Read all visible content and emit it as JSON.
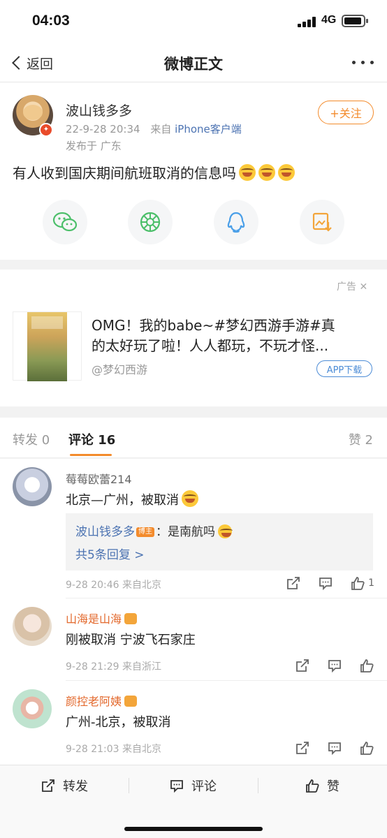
{
  "status_bar": {
    "time": "04:03",
    "network": "4G"
  },
  "nav": {
    "back_label": "返回",
    "title": "微博正文"
  },
  "post": {
    "author": "波山钱多多",
    "follow_label": "+关注",
    "time": "22-9-28 20:34",
    "from_prefix": "来自",
    "source": "iPhone客户端",
    "location": "发布于 广东",
    "text": "有人收到国庆期间航班取消的信息吗"
  },
  "share": {
    "items": [
      {
        "name": "wechat",
        "color": "#4cbf6a"
      },
      {
        "name": "moments",
        "color": "#4cbf6a"
      },
      {
        "name": "qq",
        "color": "#4a9fe8"
      },
      {
        "name": "save-image",
        "color": "#f3a53a"
      }
    ]
  },
  "ad": {
    "label": "广告",
    "line1": "OMG！我的babe~#梦幻西游手游#真",
    "line2": "的太好玩了啦！人人都玩，不玩才怪...",
    "brand": "@梦幻西游",
    "download_label": "APP下载"
  },
  "tabs": {
    "repost": "转发 0",
    "comments": "评论 16",
    "likes": "赞 2"
  },
  "comments": [
    {
      "user": "莓莓欧蕾214",
      "text": "北京—广州，被取消",
      "reply": {
        "author": "波山钱多多",
        "badge": "博主",
        "text": "：是南航吗",
        "more": "共5条回复 >"
      },
      "meta": "9-28 20:46  来自北京",
      "likes": "1"
    },
    {
      "user": "山海是山海",
      "text": "刚被取消  宁波飞石家庄",
      "meta": "9-28 21:29  来自浙江",
      "likes": ""
    },
    {
      "user": "颜控老阿姨",
      "text": "广州-北京，被取消",
      "meta": "9-28 21:03  来自北京",
      "likes": ""
    }
  ],
  "bottom_bar": {
    "repost": "转发",
    "comment": "评论",
    "like": "赞"
  },
  "colors": {
    "accent": "#f38b2c",
    "link": "#4c73b2",
    "vip_name": "#e3692d"
  }
}
